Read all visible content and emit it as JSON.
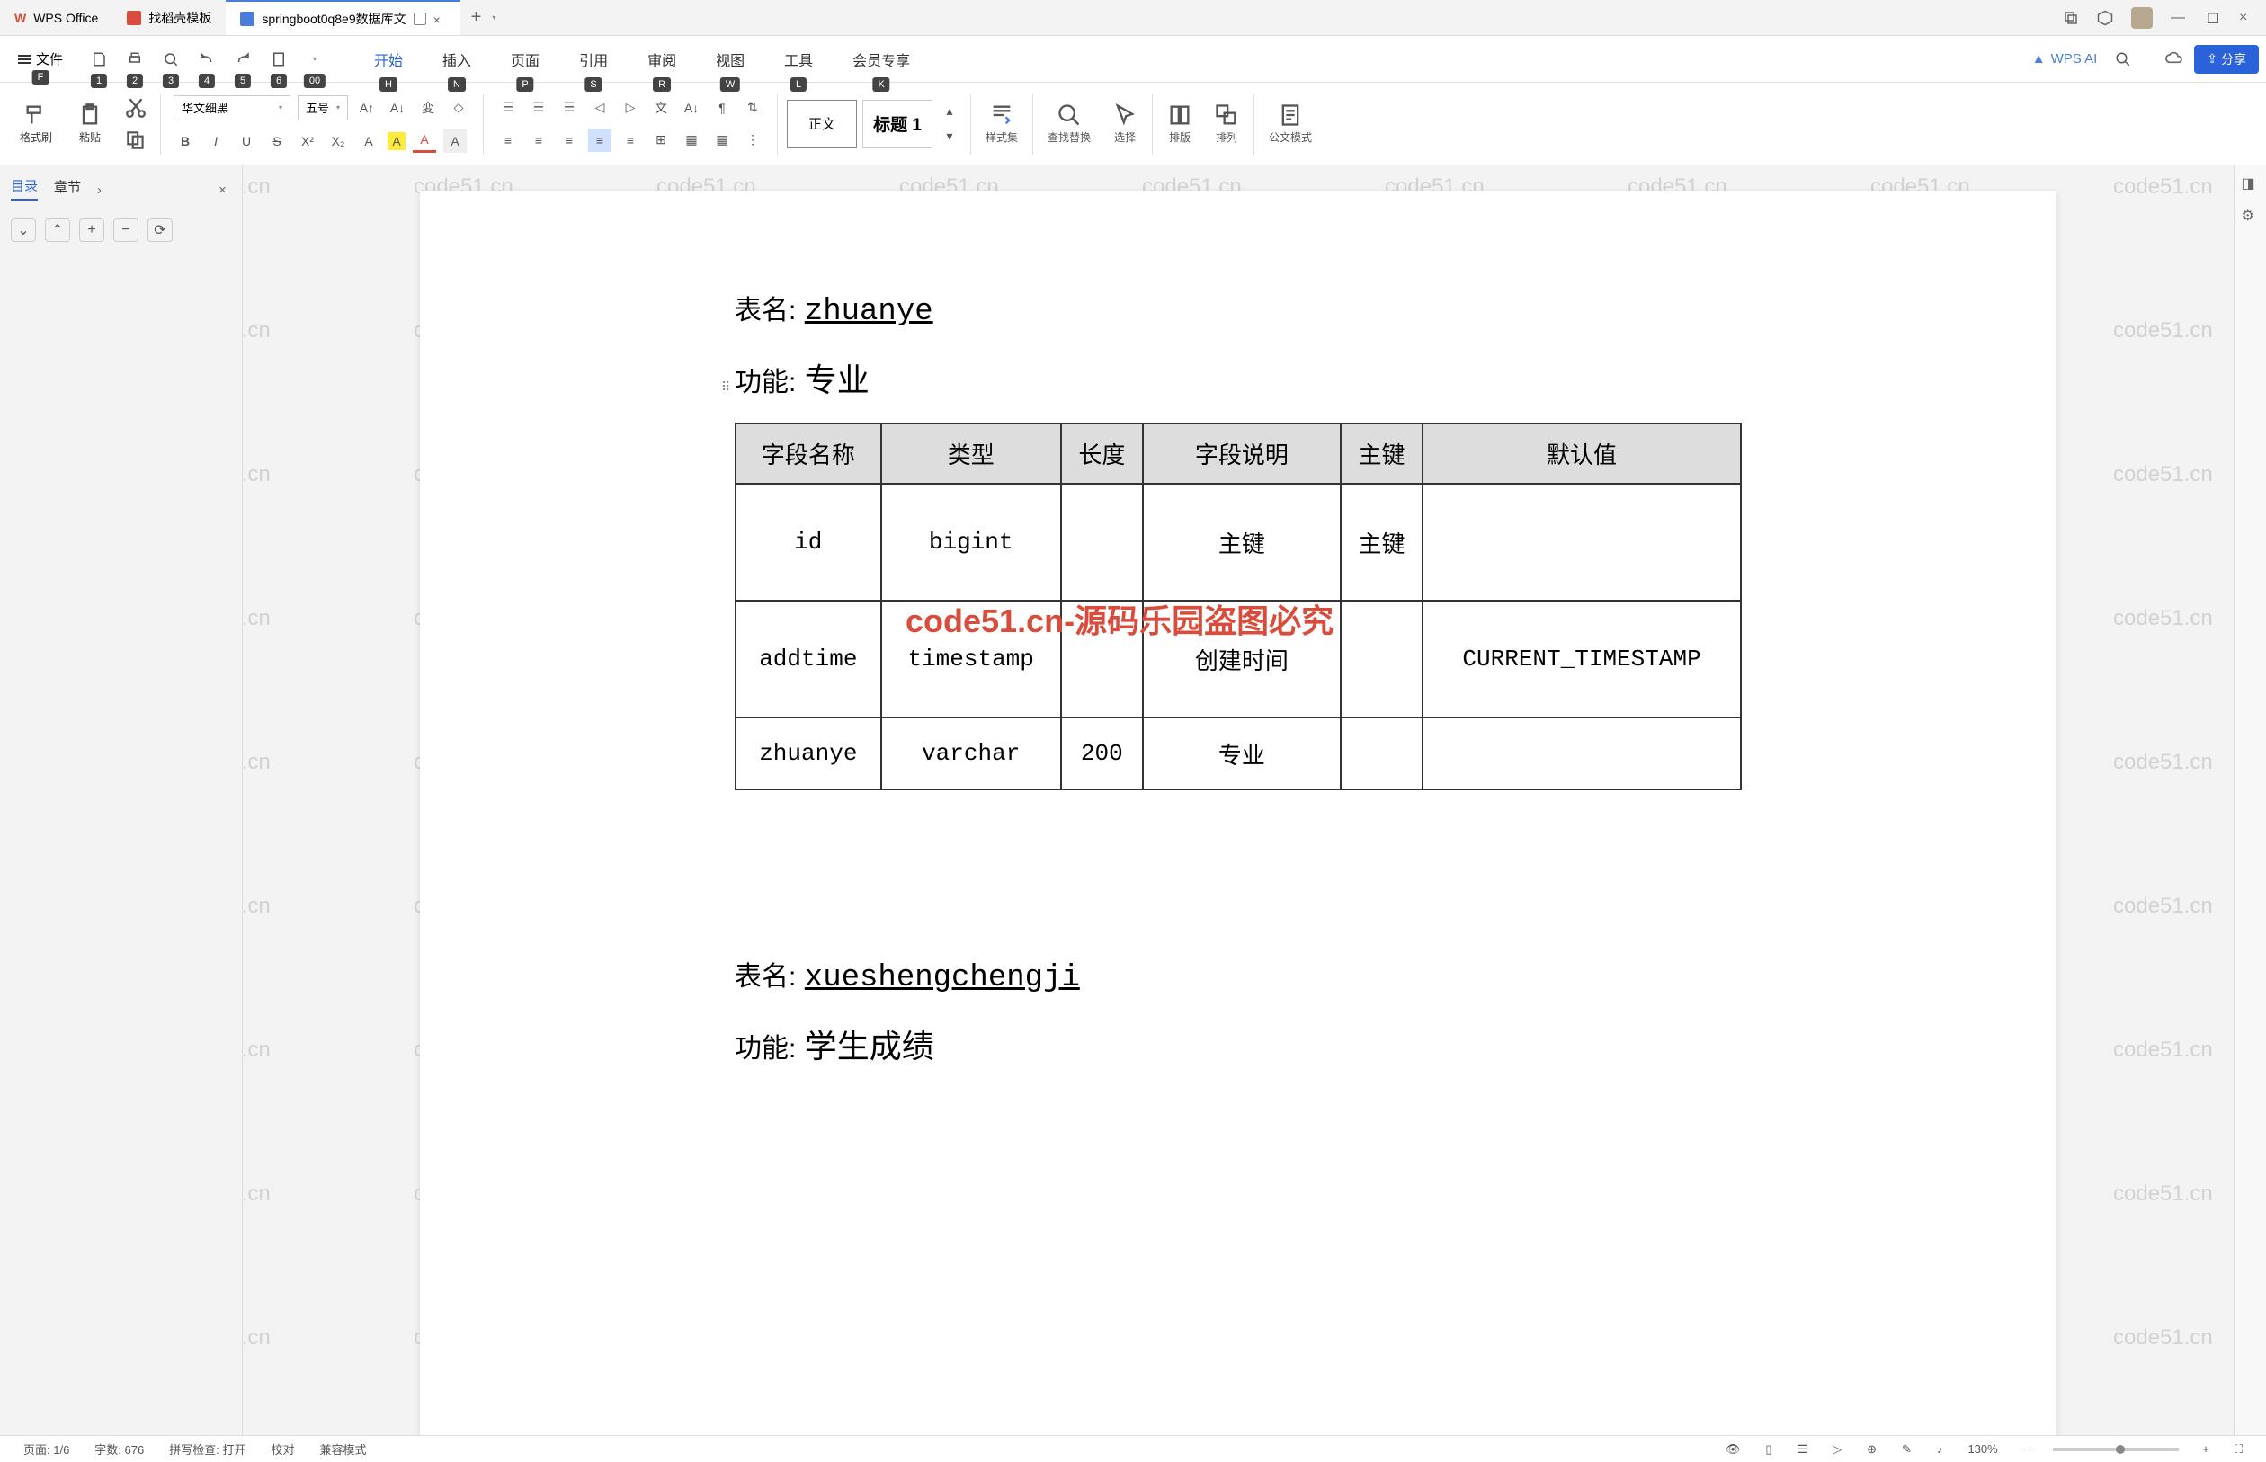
{
  "app": {
    "name": "WPS Office"
  },
  "tabs": [
    {
      "label": "找稻壳模板"
    },
    {
      "label": "springboot0q8e9数据库文"
    }
  ],
  "menu": {
    "file": "文件",
    "file_key": "F",
    "qa_keys": [
      "1",
      "2",
      "3",
      "4",
      "5",
      "6",
      "00"
    ],
    "items": [
      "开始",
      "插入",
      "页面",
      "引用",
      "审阅",
      "视图",
      "工具",
      "会员专享"
    ],
    "item_keys": [
      "H",
      "N",
      "P",
      "S",
      "R",
      "W",
      "L",
      "K"
    ],
    "active_index": 0,
    "wps_ai": "WPS AI",
    "share": "分享"
  },
  "ribbon": {
    "format_brush": "格式刷",
    "paste": "粘贴",
    "font_name": "华文细黑",
    "font_size": "五号",
    "bold": "B",
    "italic": "I",
    "underline": "U",
    "strike": "S",
    "super": "X²",
    "sub": "X₂",
    "effect": "A",
    "highlight": "A",
    "color": "A",
    "style_normal": "正文",
    "style_heading": "标题 1",
    "style_set": "样式集",
    "find_replace": "查找替换",
    "select": "选择",
    "layout": "排版",
    "arrange": "排列",
    "official_mode": "公文模式"
  },
  "sidebar": {
    "tabs": [
      "目录",
      "章节"
    ],
    "active_index": 0
  },
  "document": {
    "sections": [
      {
        "table_label": "表名:",
        "table_name": "zhuanye",
        "func_label": "功能:",
        "func_name": "专业",
        "columns": [
          "字段名称",
          "类型",
          "长度",
          "字段说明",
          "主键",
          "默认值"
        ],
        "rows": [
          {
            "name": "id",
            "type": "bigint",
            "len": "",
            "desc": "主键",
            "pk": "主键",
            "default": ""
          },
          {
            "name": "addtime",
            "type": "timestamp",
            "len": "",
            "desc": "创建时间",
            "pk": "",
            "default": "CURRENT_TIMESTAMP"
          },
          {
            "name": "zhuanye",
            "type": "varchar",
            "len": "200",
            "desc": "专业",
            "pk": "",
            "default": ""
          }
        ]
      },
      {
        "table_label": "表名:",
        "table_name": "xueshengchengji",
        "func_label": "功能:",
        "func_name": "学生成绩"
      }
    ],
    "watermark_text": "code51.cn",
    "watermark_red": "code51.cn-源码乐园盗图必究"
  },
  "status": {
    "page": "页面: 1/6",
    "words": "字数: 676",
    "spell": "拼写检查: 打开",
    "proof": "校对",
    "compat": "兼容模式",
    "zoom": "130%"
  }
}
